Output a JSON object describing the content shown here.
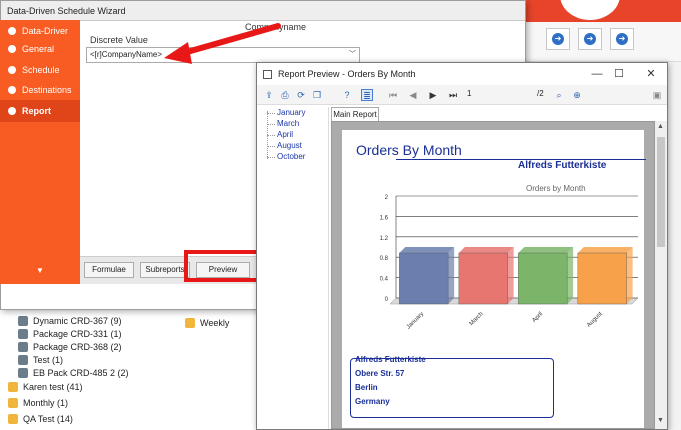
{
  "background": {
    "tree_items": [
      {
        "label": "Dynamic CRD-367 (9)",
        "kind": "package"
      },
      {
        "label": "Package CRD-331 (1)",
        "kind": "package"
      },
      {
        "label": "Package CRD-368 (2)",
        "kind": "package"
      },
      {
        "label": "Test (1)",
        "kind": "package"
      },
      {
        "label": "EB Pack CRD-485 2 (2)",
        "kind": "package"
      },
      {
        "label": "Karen test (41)",
        "kind": "folder"
      },
      {
        "label": "Monthly (1)",
        "kind": "folder"
      },
      {
        "label": "QA Test (14)",
        "kind": "folder"
      }
    ],
    "weekly_label": "Weekly",
    "toolbar_icons": [
      "circle-arrow-icon",
      "circle-arrow-icon",
      "circle-arrow-icon"
    ]
  },
  "wizard": {
    "title": "Data-Driven Schedule Wizard",
    "nav": [
      {
        "label": "Data-Driver",
        "icon": "data-icon",
        "active": false
      },
      {
        "label": "General",
        "icon": "info-icon",
        "active": false
      },
      {
        "label": "Schedule",
        "icon": "clock-icon",
        "active": false
      },
      {
        "label": "Destinations",
        "icon": "destination-icon",
        "active": false
      },
      {
        "label": "Report",
        "icon": "report-icon",
        "active": true
      }
    ],
    "field_caption": "Companyname",
    "discrete_label": "Discrete Value",
    "discrete_value": "<[r]CompanyName>",
    "buttons": {
      "formulae": "Formulae",
      "subreports": "Subreports",
      "preview": "Preview"
    },
    "nav_expand_glyph": "▼"
  },
  "preview": {
    "title": "Report Preview - Orders By Month",
    "window_buttons": {
      "minimize": "—",
      "maximize": "☐",
      "close": "✕"
    },
    "page_current": "1",
    "page_total": "/2",
    "tree": [
      "January",
      "March",
      "April",
      "August",
      "October"
    ],
    "tab_label": "Main Report",
    "report": {
      "title": "Orders By Month",
      "company": "Alfreds Futterkiste",
      "address_lines": [
        "Alfreds Futterkiste",
        "Obere Str. 57",
        "Berlin",
        "Germany"
      ]
    }
  },
  "colors": {
    "accent": "#f85c22",
    "report_blue": "#1a2f96",
    "highlight_red": "#e81818"
  },
  "chart_data": {
    "type": "bar",
    "title": "Orders by Month",
    "categories": [
      "January",
      "March",
      "April",
      "August"
    ],
    "values": [
      1,
      1,
      1,
      1
    ],
    "colors": [
      "#6a7fae",
      "#e77670",
      "#7bb56a",
      "#f7a24a"
    ],
    "ylim": [
      0,
      2
    ],
    "yticks": [
      "0",
      "0.4",
      "0.8",
      "1.2",
      "1.6",
      "2"
    ],
    "xlabel": "",
    "ylabel": "",
    "grid": true
  }
}
